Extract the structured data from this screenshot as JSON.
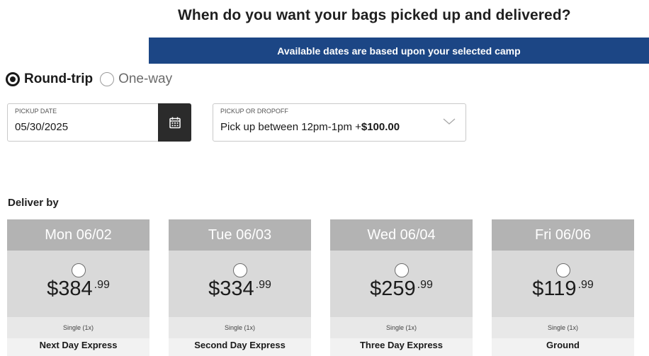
{
  "page": {
    "title": "When do you want your bags picked up and delivered?",
    "banner": "Available dates are based upon your selected camp"
  },
  "trip_type": {
    "options": [
      {
        "label": "Round-trip",
        "selected": true
      },
      {
        "label": "One-way",
        "selected": false
      }
    ]
  },
  "pickup_date": {
    "label": "PICKUP DATE",
    "value": "05/30/2025",
    "icon": "calendar-icon"
  },
  "pickup_option": {
    "label": "PICKUP OR DROPOFF",
    "value_text": "Pick up between 12pm-1pm +",
    "value_price": "$100.00",
    "icon": "chevron-down-icon"
  },
  "deliver_by": {
    "label": "Deliver by",
    "options": [
      {
        "date": "Mon 06/02",
        "price_main": "$384",
        "price_cents": ".99",
        "qty": "Single (1x)",
        "service": "Next Day Express"
      },
      {
        "date": "Tue 06/03",
        "price_main": "$334",
        "price_cents": ".99",
        "qty": "Single (1x)",
        "service": "Second Day Express"
      },
      {
        "date": "Wed 06/04",
        "price_main": "$259",
        "price_cents": ".99",
        "qty": "Single (1x)",
        "service": "Three Day Express"
      },
      {
        "date": "Fri 06/06",
        "price_main": "$119",
        "price_cents": ".99",
        "qty": "Single (1x)",
        "service": "Ground"
      }
    ]
  },
  "colors": {
    "banner_bg": "#1c4685",
    "card_header": "#b3b3b3",
    "card_body": "#d9d9d9",
    "calendar_button": "#2b2b2b"
  }
}
